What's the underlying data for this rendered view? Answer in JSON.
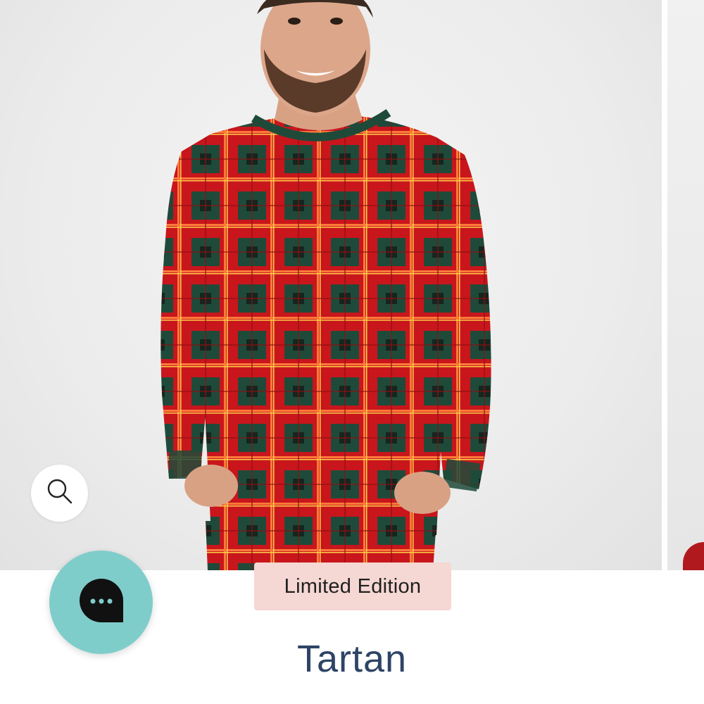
{
  "product": {
    "badge": "Limited Edition",
    "title": "Tartan"
  },
  "gallery": {
    "main_image_alt": "Man wearing red and green tartan long sleeve pajama top",
    "zoom_icon": "search-icon"
  },
  "chat": {
    "icon": "chat-bubble-dots-icon"
  },
  "colors": {
    "chat_button": "#7fcdcb",
    "badge_bg": "#f5d7d3",
    "title_text": "#2e4466",
    "plaid_red": "#c8161c",
    "plaid_green": "#1f4a3a"
  }
}
